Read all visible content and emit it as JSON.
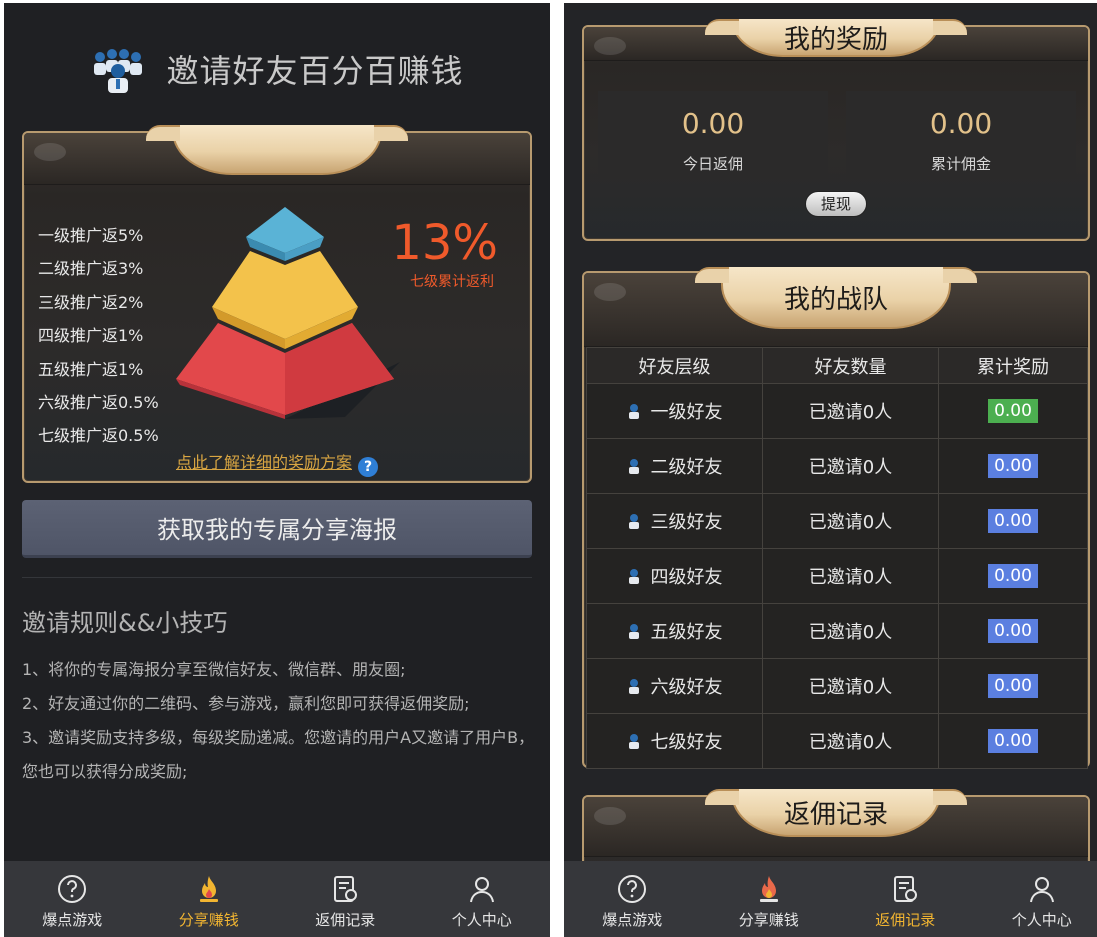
{
  "left": {
    "header_title": "邀请好友百分百赚钱",
    "levels": [
      "一级推广返5%",
      "二级推广返3%",
      "三级推广返2%",
      "四级推广返1%",
      "五级推广返1%",
      "六级推广返0.5%",
      "七级推广返0.5%"
    ],
    "percent": "13%",
    "percent_label": "七级累计返利",
    "detail_link": "点此了解详细的奖励方案",
    "poster_button": "获取我的专属分享海报",
    "rules_title": "邀请规则&&小技巧",
    "rules": [
      "1、将你的专属海报分享至微信好友、微信群、朋友圈;",
      "2、好友通过你的二维码、参与游戏，赢利您即可获得返佣奖励;",
      "3、邀请奖励支持多级，每级奖励递减。您邀请的用户A又邀请了用户B，您也可以获得分成奖励;"
    ],
    "tabs": [
      "爆点游戏",
      "分享赚钱",
      "返佣记录",
      "个人中心"
    ],
    "active_tab": "分享赚钱"
  },
  "right": {
    "rewards_title": "我的奖励",
    "today_value": "0.00",
    "today_label": "今日返佣",
    "total_value": "0.00",
    "total_label": "累计佣金",
    "withdraw_button": "提现",
    "team_title": "我的战队",
    "table_headers": [
      "好友层级",
      "好友数量",
      "累计奖励"
    ],
    "table_rows": [
      {
        "level": "一级好友",
        "count": "已邀请0人",
        "reward": "0.00"
      },
      {
        "level": "二级好友",
        "count": "已邀请0人",
        "reward": "0.00"
      },
      {
        "level": "三级好友",
        "count": "已邀请0人",
        "reward": "0.00"
      },
      {
        "level": "四级好友",
        "count": "已邀请0人",
        "reward": "0.00"
      },
      {
        "level": "五级好友",
        "count": "已邀请0人",
        "reward": "0.00"
      },
      {
        "level": "六级好友",
        "count": "已邀请0人",
        "reward": "0.00"
      },
      {
        "level": "七级好友",
        "count": "已邀请0人",
        "reward": "0.00"
      }
    ],
    "records_title": "返佣记录",
    "tabs": [
      "爆点游戏",
      "分享赚钱",
      "返佣记录",
      "个人中心"
    ],
    "active_tab": "返佣记录"
  },
  "colors": {
    "accent_gold": "#f2b531",
    "percent_orange": "#f05a2b",
    "reward_green": "#4caf50",
    "reward_blue": "#5b7fe0",
    "poster_button": "#565c6e"
  }
}
